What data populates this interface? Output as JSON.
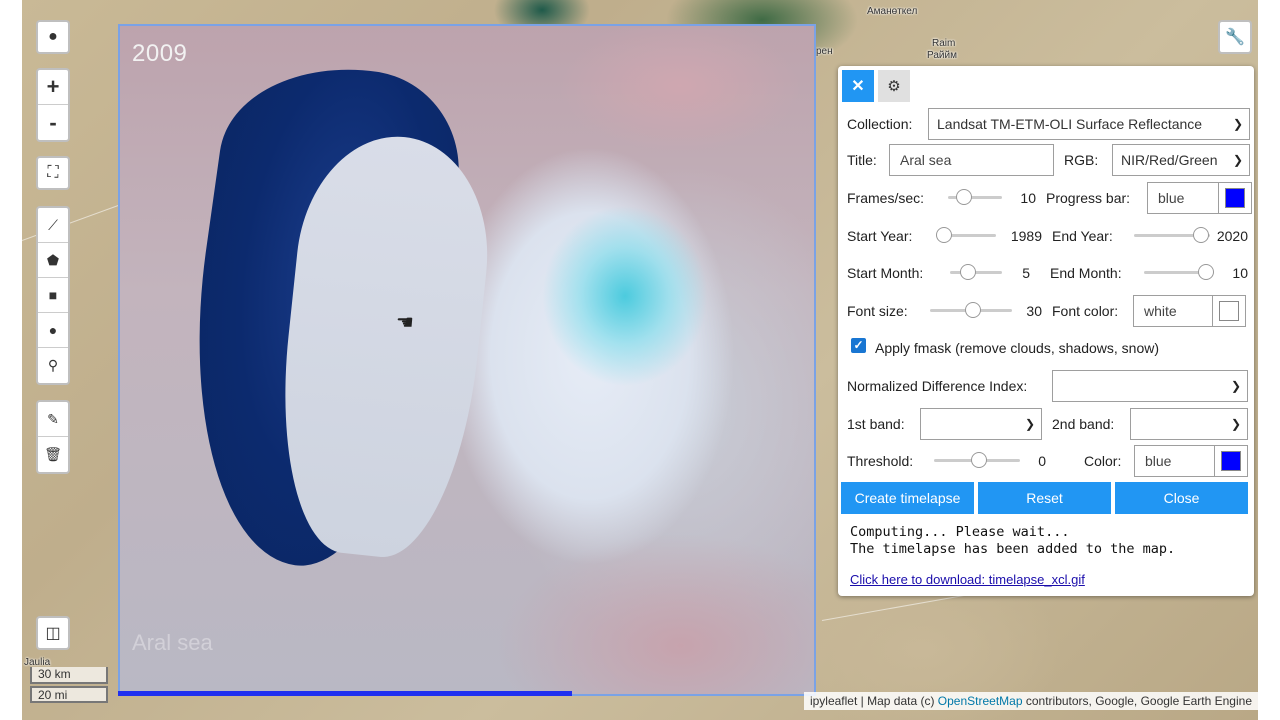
{
  "map": {
    "year_label": "2009",
    "overlay_title": "Aral sea",
    "progress_fraction": 0.65,
    "labels": {
      "town1": "Аманөткел",
      "town2a": "Raim",
      "town2b": "Раййм",
      "town3": "Jaulia",
      "edge_ren": "рен"
    },
    "scale_km": "30 km",
    "scale_mi": "20 mi",
    "attribution_prefix": "ipyleaflet | Map data (c) ",
    "attribution_link": "OpenStreetMap",
    "attribution_suffix": " contributors, Google, Google Earth Engine"
  },
  "toolbar": {
    "globe": "globe-icon",
    "zoom_in": "+",
    "zoom_out": "-",
    "fullscreen": "fullscreen-icon",
    "draw": [
      "polyline-icon",
      "polygon-icon",
      "rectangle-icon",
      "circle-icon",
      "marker-icon"
    ],
    "edit": [
      "edit-icon",
      "trash-icon"
    ],
    "measure": "ruler-icon",
    "wrench": "wrench-icon"
  },
  "panel": {
    "close_icon": "close-icon",
    "settings_icon": "gear-icon",
    "collection_label": "Collection:",
    "collection_value": "Landsat TM-ETM-OLI Surface Reflectance",
    "title_label": "Title:",
    "title_value": "Aral sea",
    "rgb_label": "RGB:",
    "rgb_value": "NIR/Red/Green",
    "frames_label": "Frames/sec:",
    "frames_value": "10",
    "progress_label": "Progress bar:",
    "progress_color": "blue",
    "progress_color_hex": "#0000ff",
    "start_year_label": "Start Year:",
    "start_year_value": "1989",
    "end_year_label": "End Year:",
    "end_year_value": "2020",
    "start_month_label": "Start Month:",
    "start_month_value": "5",
    "end_month_label": "End Month:",
    "end_month_value": "10",
    "font_size_label": "Font size:",
    "font_size_value": "30",
    "font_color_label": "Font color:",
    "font_color_value": "white",
    "font_color_hex": "#ffffff",
    "fmask_label": "Apply fmask (remove clouds, shadows, snow)",
    "ndi_label": "Normalized Difference Index:",
    "ndi_value": "",
    "band1_label": "1st band:",
    "band1_value": "",
    "band2_label": "2nd band:",
    "band2_value": "",
    "threshold_label": "Threshold:",
    "threshold_value": "0",
    "color_label": "Color:",
    "color_value": "blue",
    "color_hex": "#0000ff",
    "create_button": "Create timelapse",
    "reset_button": "Reset",
    "close_button": "Close",
    "console_line1": "Computing... Please wait...",
    "console_line2": "The timelapse has been added to the map.",
    "download_link": "Click here to download: timelapse_xcl.gif"
  }
}
